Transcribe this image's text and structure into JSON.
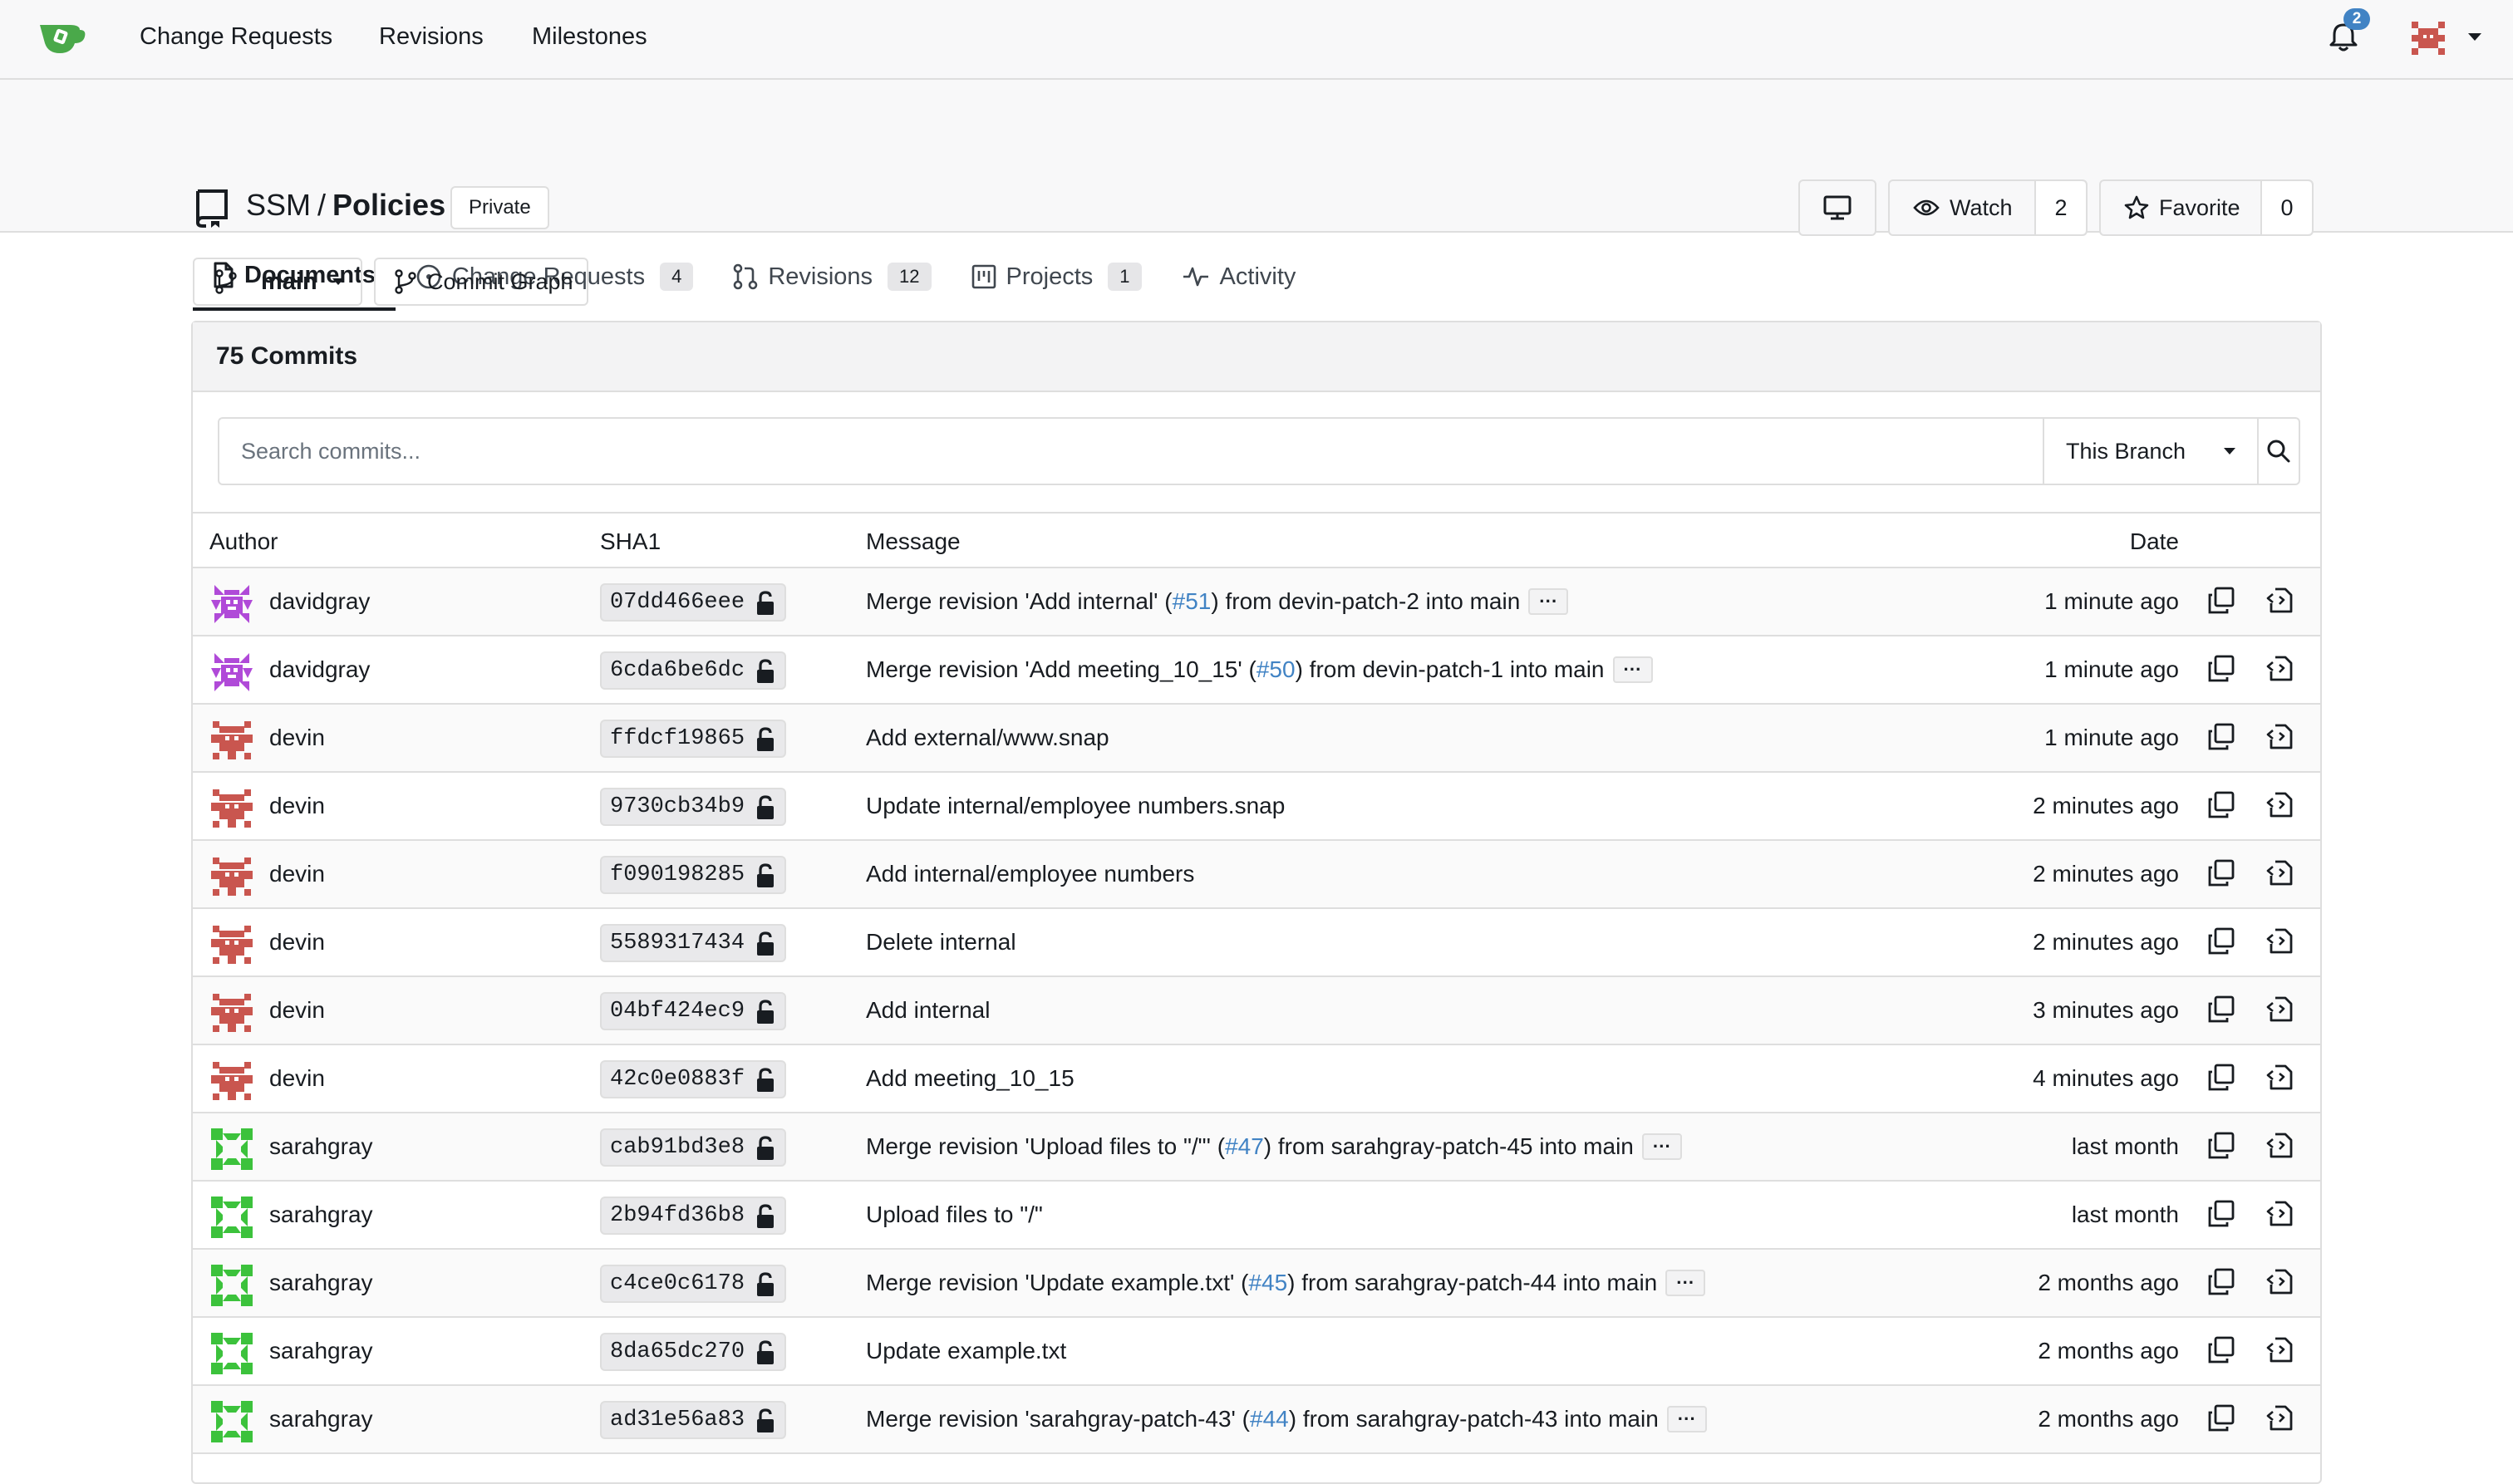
{
  "nav": {
    "items": [
      "Change Requests",
      "Revisions",
      "Milestones"
    ],
    "notification_count": "2"
  },
  "repo": {
    "owner": "SSM",
    "separator": "/",
    "name": "Policies",
    "visibility": "Private",
    "watch_label": "Watch",
    "watch_count": "2",
    "favorite_label": "Favorite",
    "favorite_count": "0"
  },
  "tabs": [
    {
      "label": "Documents",
      "count": ""
    },
    {
      "label": "Change Requests",
      "count": "4"
    },
    {
      "label": "Revisions",
      "count": "12"
    },
    {
      "label": "Projects",
      "count": "1"
    },
    {
      "label": "Activity",
      "count": ""
    }
  ],
  "branch": {
    "current": "main",
    "graph_label": "Commit Graph"
  },
  "commits": {
    "heading": "75 Commits",
    "search_placeholder": "Search commits...",
    "scope": "This Branch",
    "columns": {
      "author": "Author",
      "sha": "SHA1",
      "message": "Message",
      "date": "Date"
    },
    "rows": [
      {
        "author": "davidgray",
        "sha": "07dd466eee",
        "msg_pre": "Merge revision 'Add internal' (",
        "link": "#51",
        "msg_post": ") from devin-patch-2 into main",
        "ellipsis": "···",
        "date": "1 minute ago",
        "avatar": "purple"
      },
      {
        "author": "davidgray",
        "sha": "6cda6be6dc",
        "msg_pre": "Merge revision 'Add meeting_10_15' (",
        "link": "#50",
        "msg_post": ") from devin-patch-1 into main",
        "ellipsis": "···",
        "date": "1 minute ago",
        "avatar": "purple"
      },
      {
        "author": "devin",
        "sha": "ffdcf19865",
        "msg_pre": "Add external/www.snap",
        "link": "",
        "msg_post": "",
        "ellipsis": "",
        "date": "1 minute ago",
        "avatar": "red"
      },
      {
        "author": "devin",
        "sha": "9730cb34b9",
        "msg_pre": "Update internal/employee numbers.snap",
        "link": "",
        "msg_post": "",
        "ellipsis": "",
        "date": "2 minutes ago",
        "avatar": "red"
      },
      {
        "author": "devin",
        "sha": "f090198285",
        "msg_pre": "Add internal/employee numbers",
        "link": "",
        "msg_post": "",
        "ellipsis": "",
        "date": "2 minutes ago",
        "avatar": "red"
      },
      {
        "author": "devin",
        "sha": "5589317434",
        "msg_pre": "Delete internal",
        "link": "",
        "msg_post": "",
        "ellipsis": "",
        "date": "2 minutes ago",
        "avatar": "red"
      },
      {
        "author": "devin",
        "sha": "04bf424ec9",
        "msg_pre": "Add internal",
        "link": "",
        "msg_post": "",
        "ellipsis": "",
        "date": "3 minutes ago",
        "avatar": "red"
      },
      {
        "author": "devin",
        "sha": "42c0e0883f",
        "msg_pre": "Add meeting_10_15",
        "link": "",
        "msg_post": "",
        "ellipsis": "",
        "date": "4 minutes ago",
        "avatar": "red"
      },
      {
        "author": "sarahgray",
        "sha": "cab91bd3e8",
        "msg_pre": "Merge revision 'Upload files to \"/\"' (",
        "link": "#47",
        "msg_post": ") from sarahgray-patch-45 into main",
        "ellipsis": "···",
        "date": "last month",
        "avatar": "green"
      },
      {
        "author": "sarahgray",
        "sha": "2b94fd36b8",
        "msg_pre": "Upload files to \"/\"",
        "link": "",
        "msg_post": "",
        "ellipsis": "",
        "date": "last month",
        "avatar": "green"
      },
      {
        "author": "sarahgray",
        "sha": "c4ce0c6178",
        "msg_pre": "Merge revision 'Update example.txt' (",
        "link": "#45",
        "msg_post": ") from sarahgray-patch-44 into main",
        "ellipsis": "···",
        "date": "2 months ago",
        "avatar": "green"
      },
      {
        "author": "sarahgray",
        "sha": "8da65dc270",
        "msg_pre": "Update example.txt",
        "link": "",
        "msg_post": "",
        "ellipsis": "",
        "date": "2 months ago",
        "avatar": "green"
      },
      {
        "author": "sarahgray",
        "sha": "ad31e56a83",
        "msg_pre": "Merge revision 'sarahgray-patch-43' (",
        "link": "#44",
        "msg_post": ") from sarahgray-patch-43 into main",
        "ellipsis": "···",
        "date": "2 months ago",
        "avatar": "green"
      }
    ]
  },
  "colors": {
    "link": "#4183c4",
    "logo": "#4aa94a",
    "avatar_purple": "#b04ad8",
    "avatar_red": "#c9564f",
    "avatar_green": "#3cc23c"
  }
}
